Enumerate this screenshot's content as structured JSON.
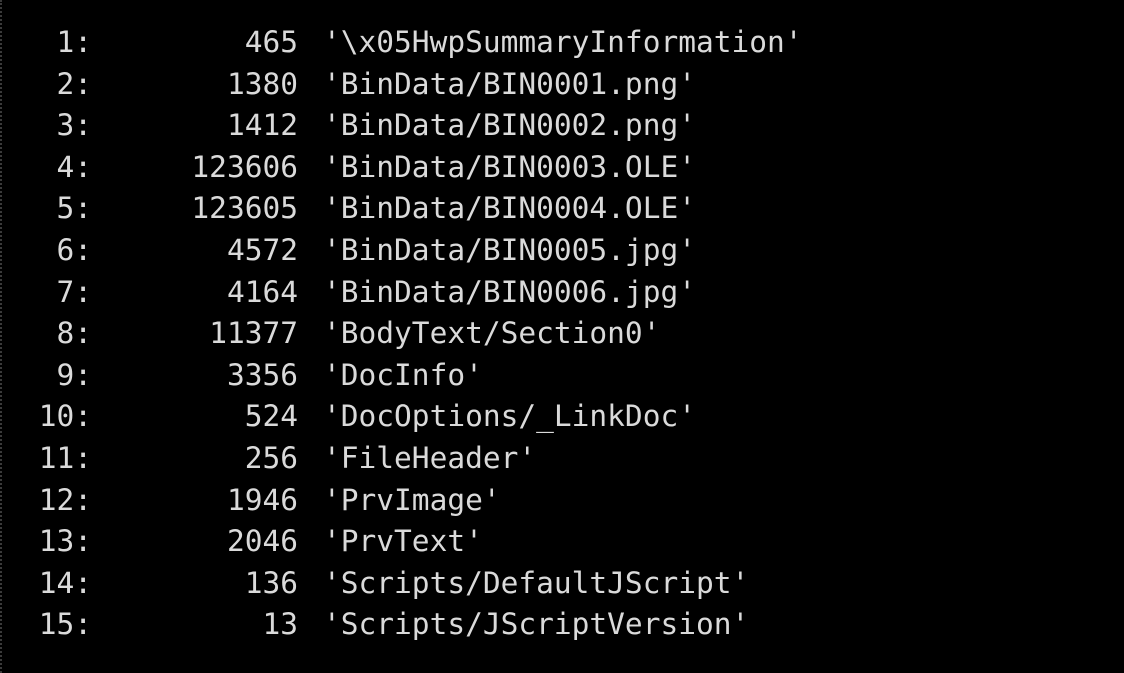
{
  "terminal": {
    "rows": [
      {
        "index": "1:",
        "size": "465",
        "name": "'\\x05HwpSummaryInformation'"
      },
      {
        "index": "2:",
        "size": "1380",
        "name": "'BinData/BIN0001.png'"
      },
      {
        "index": "3:",
        "size": "1412",
        "name": "'BinData/BIN0002.png'"
      },
      {
        "index": "4:",
        "size": "123606",
        "name": "'BinData/BIN0003.OLE'"
      },
      {
        "index": "5:",
        "size": "123605",
        "name": "'BinData/BIN0004.OLE'"
      },
      {
        "index": "6:",
        "size": "4572",
        "name": "'BinData/BIN0005.jpg'"
      },
      {
        "index": "7:",
        "size": "4164",
        "name": "'BinData/BIN0006.jpg'"
      },
      {
        "index": "8:",
        "size": "11377",
        "name": "'BodyText/Section0'"
      },
      {
        "index": "9:",
        "size": "3356",
        "name": "'DocInfo'"
      },
      {
        "index": "10:",
        "size": "524",
        "name": "'DocOptions/_LinkDoc'"
      },
      {
        "index": "11:",
        "size": "256",
        "name": "'FileHeader'"
      },
      {
        "index": "12:",
        "size": "1946",
        "name": "'PrvImage'"
      },
      {
        "index": "13:",
        "size": "2046",
        "name": "'PrvText'"
      },
      {
        "index": "14:",
        "size": "136",
        "name": "'Scripts/DefaultJScript'"
      },
      {
        "index": "15:",
        "size": "13",
        "name": "'Scripts/JScriptVersion'"
      }
    ]
  }
}
